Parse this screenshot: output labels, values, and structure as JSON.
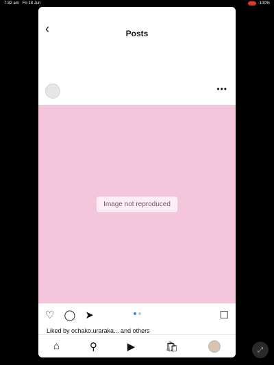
{
  "statusbar": {
    "time": "7:32 am",
    "date": "Fri 18 Jun",
    "battery": "100%"
  },
  "nav": {
    "back_icon": "chevron-left-icon",
    "title": "Posts"
  },
  "post": {
    "image_placeholder": "Image not reproduced",
    "more_icon": "more-horizontal-icon"
  },
  "actions": {
    "like_icon": "heart-icon",
    "comment_icon": "comment-icon",
    "share_icon": "send-icon",
    "save_icon": "bookmark-icon"
  },
  "likes": {
    "text": "Liked by ochako.uraraka... and others"
  },
  "tabbar": [
    "home-icon",
    "search-icon",
    "reels-icon",
    "shop-icon",
    "profile-avatar"
  ],
  "colors": {
    "accent": "#3b82f6",
    "recording": "#e0342e"
  }
}
